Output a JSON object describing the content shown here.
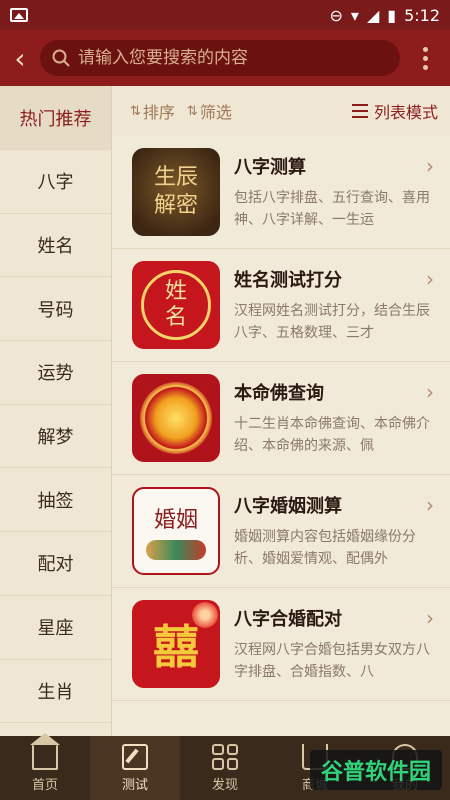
{
  "status_bar": {
    "time": "5:12"
  },
  "search": {
    "placeholder": "请输入您要搜索的内容"
  },
  "sidebar": {
    "items": [
      {
        "label": "热门推荐",
        "active": true
      },
      {
        "label": "八字"
      },
      {
        "label": "姓名"
      },
      {
        "label": "号码"
      },
      {
        "label": "运势"
      },
      {
        "label": "解梦"
      },
      {
        "label": "抽签"
      },
      {
        "label": "配对"
      },
      {
        "label": "星座"
      },
      {
        "label": "生肖"
      }
    ]
  },
  "toolbar": {
    "sort_label": "排序",
    "filter_label": "筛选",
    "mode_label": "列表模式"
  },
  "list": {
    "items": [
      {
        "title": "八字测算",
        "desc": "包括八字排盘、五行查询、喜用神、八字详解、一生运",
        "thumb_text": "生辰解密"
      },
      {
        "title": "姓名测试打分",
        "desc": "汉程网姓名测试打分，结合生辰八字、五格数理、三才",
        "thumb_text": "姓名"
      },
      {
        "title": "本命佛查询",
        "desc": "十二生肖本命佛查询、本命佛介绍、本命佛的来源、佩"
      },
      {
        "title": "八字婚姻测算",
        "desc": "婚姻测算内容包括婚姻缘份分析、婚姻爱情观、配偶外",
        "thumb_text": "婚姻"
      },
      {
        "title": "八字合婚配对",
        "desc": "汉程网八字合婚包括男女双方八字排盘、合婚指数、八",
        "thumb_text": "囍"
      }
    ]
  },
  "bottom_nav": {
    "items": [
      {
        "label": "首页",
        "icon": "home-icon"
      },
      {
        "label": "测试",
        "icon": "edit-icon",
        "active": true
      },
      {
        "label": "发现",
        "icon": "grid-icon"
      },
      {
        "label": "商城",
        "icon": "cart-icon"
      },
      {
        "label": "我的",
        "icon": "user-icon"
      }
    ]
  },
  "watermark": {
    "text": "谷普软件园"
  },
  "colors": {
    "brand": "#8c1d1c",
    "background": "#efe6d3",
    "nav_bg": "#3a2a1c"
  }
}
